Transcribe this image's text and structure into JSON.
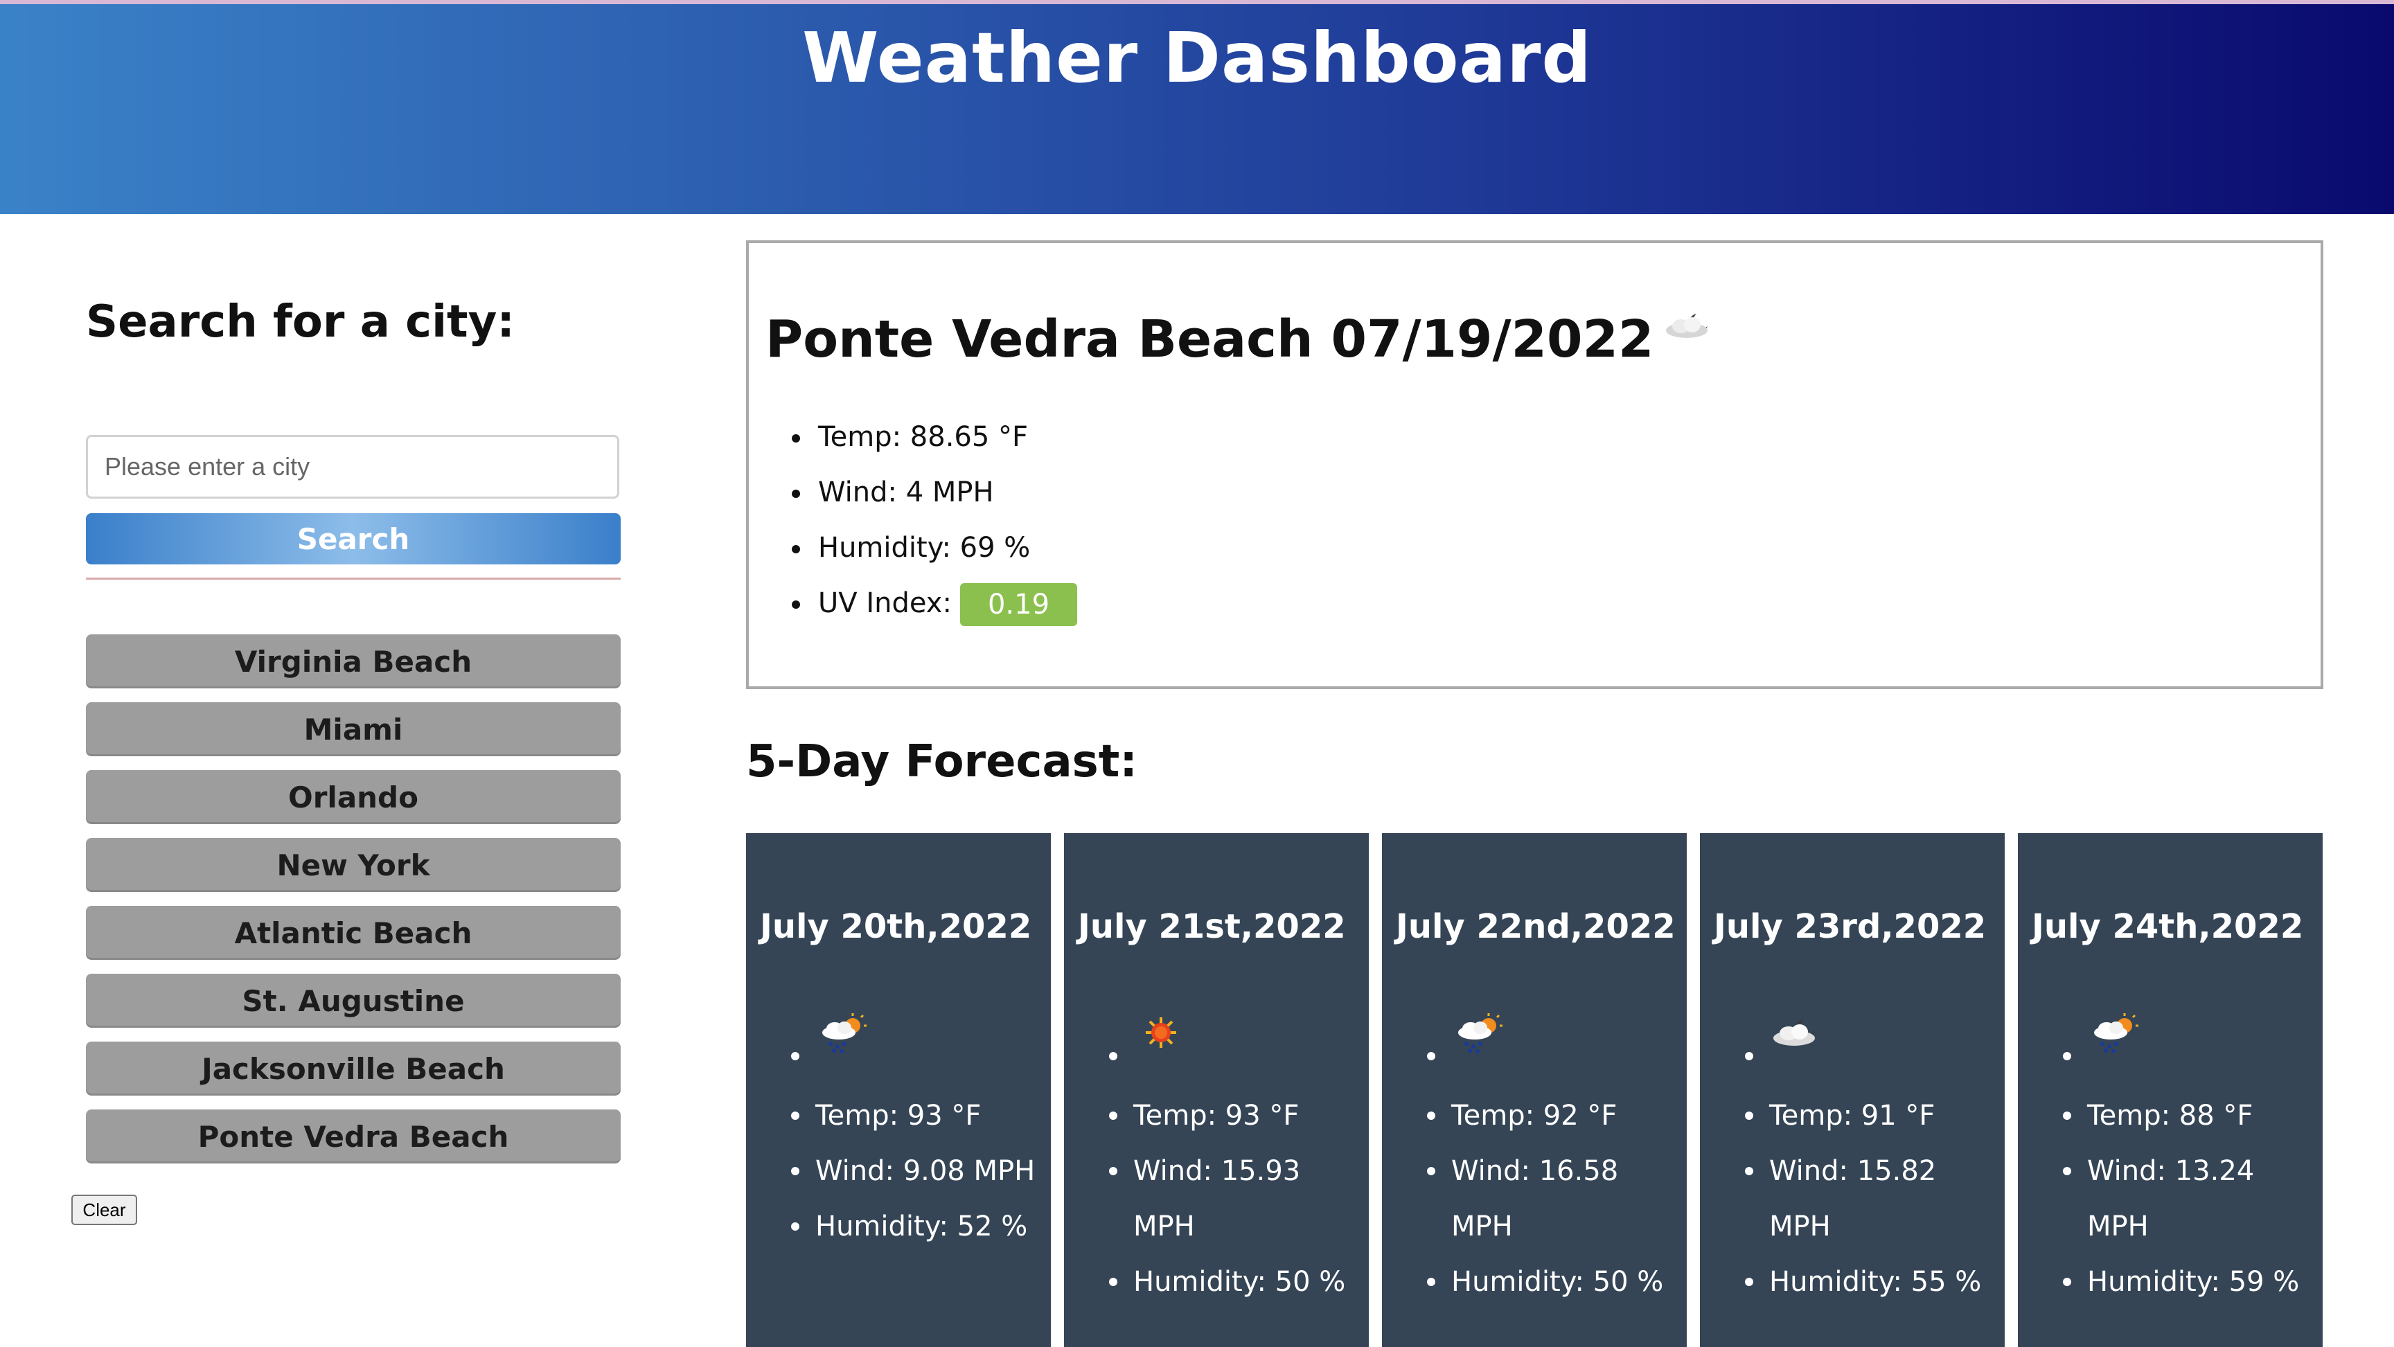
{
  "header": {
    "title": "Weather Dashboard"
  },
  "sidebar": {
    "title": "Search for a city:",
    "search_placeholder": "Please enter a city",
    "search_button": "Search",
    "cities": [
      "Virginia Beach",
      "Miami",
      "Orlando",
      "New York",
      "Atlantic Beach",
      "St. Augustine",
      "Jacksonville Beach",
      "Ponte Vedra Beach"
    ],
    "clear_button": "Clear"
  },
  "current": {
    "title": "Ponte Vedra Beach 07/19/2022",
    "icon": "cloudy-moon-icon",
    "temp": "Temp: 88.65 °F",
    "wind": "Wind: 4 MPH",
    "humidity": "Humidity: 69 %",
    "uv_label": "UV Index:",
    "uv_value": "0.19",
    "uv_color": "#8bc04e"
  },
  "forecast": {
    "heading": "5-Day Forecast:",
    "days": [
      {
        "date": "July 20th,2022",
        "icon": "sun-rain-cloud-icon",
        "temp": "Temp: 93 °F",
        "wind": "Wind: 9.08 MPH",
        "humidity": "Humidity: 52 %"
      },
      {
        "date": "July 21st,2022",
        "icon": "sun-icon",
        "temp": "Temp: 93 °F",
        "wind": "Wind: 15.93 MPH",
        "humidity": "Humidity: 50 %"
      },
      {
        "date": "July 22nd,2022",
        "icon": "sun-rain-cloud-icon",
        "temp": "Temp: 92 °F",
        "wind": "Wind: 16.58 MPH",
        "humidity": "Humidity: 50 %"
      },
      {
        "date": "July 23rd,2022",
        "icon": "cloudy-moon-icon",
        "temp": "Temp: 91 °F",
        "wind": "Wind: 15.82 MPH",
        "humidity": "Humidity: 55 %"
      },
      {
        "date": "July 24th,2022",
        "icon": "sun-rain-cloud-icon",
        "temp": "Temp: 88 °F",
        "wind": "Wind: 13.24 MPH",
        "humidity": "Humidity: 59 %"
      }
    ]
  },
  "colors": {
    "header_gradient_start": "#3a82c8",
    "header_gradient_end": "#0a0a6e",
    "city_button": "#9d9d9d",
    "forecast_card": "#354556"
  }
}
